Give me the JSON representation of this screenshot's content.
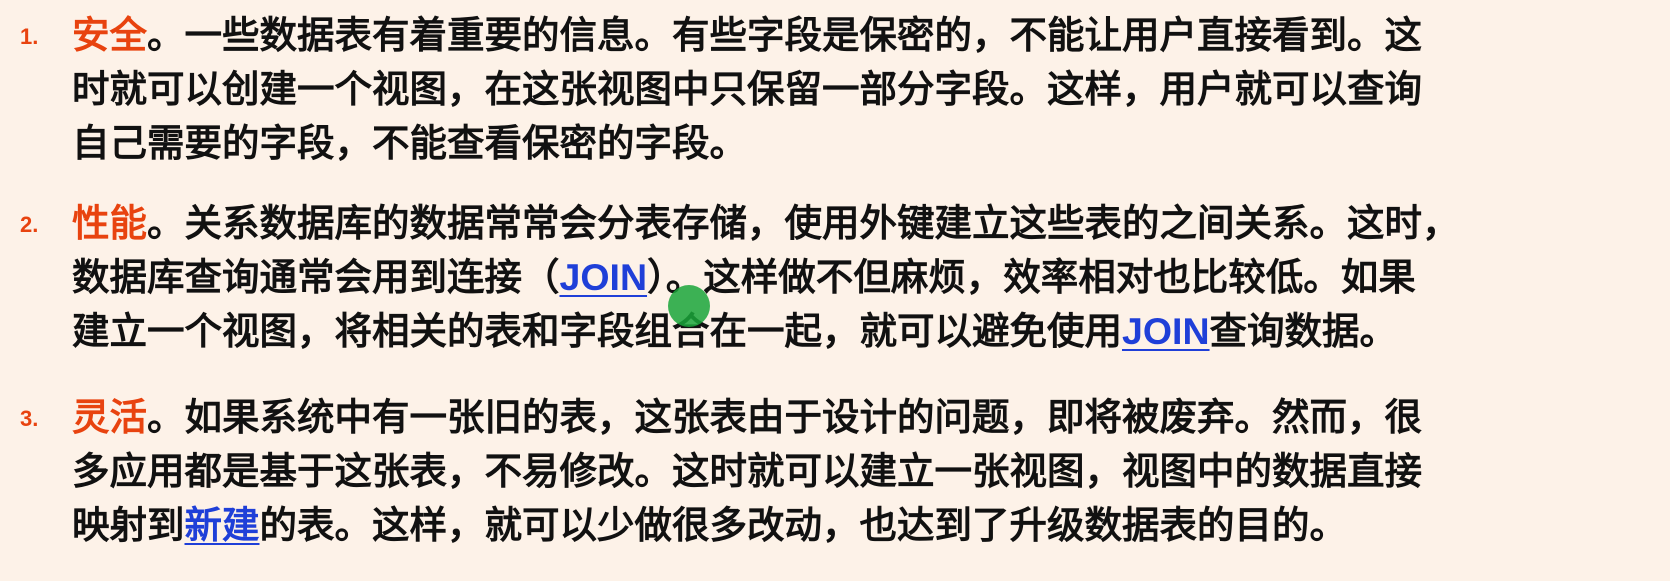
{
  "items": [
    {
      "number": "1.",
      "keyword": "安全",
      "lines": [
        {
          "text1": "。一些数据表有着重要的信息。有些字段是保密的，不能让用户直接看到。这"
        },
        {
          "text1": "时就可以创建一个视图，在这张视图中只保留一部分字段。这样，用户就可以查询"
        },
        {
          "text1": "自己需要的字段，不能查看保密的字段。"
        }
      ]
    },
    {
      "number": "2.",
      "keyword": "性能",
      "lines": [
        {
          "text1": "。关系数据库的数据常常会分表存储，使用外键建立这些表的之间关系。这时，"
        },
        {
          "text1": "数据库查询通常会用到连接（",
          "link": "JOIN",
          "text2": "）。这样做不但麻烦，效率相对也比较低。如果"
        },
        {
          "text1": "建立一个视图，将相关的表和字段组合在一起，就可以避免使用",
          "link": "JOIN",
          "text2": "查询数据。"
        }
      ]
    },
    {
      "number": "3.",
      "keyword": "灵活",
      "lines": [
        {
          "text1": "。如果系统中有一张旧的表，这张表由于设计的问题，即将被废弃。然而，很"
        },
        {
          "text1": "多应用都是基于这张表，不易修改。这时就可以建立一张视图，视图中的数据直接"
        },
        {
          "text1": "映射到",
          "link": "新建",
          "text2": "的表。这样，就可以少做很多改动，也达到了升级数据表的目的。"
        }
      ]
    }
  ],
  "colors": {
    "background": "#fdf2e8",
    "keyword": "#e8430f",
    "link": "#1f3fd8",
    "text": "#111111",
    "cursor": "#1aa63a"
  },
  "cursor_icon": "pointer-highlight-icon"
}
